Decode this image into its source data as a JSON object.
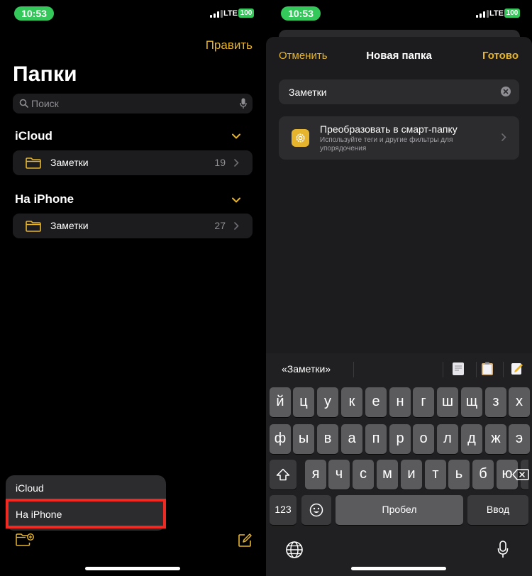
{
  "status_left": {
    "time": "10:53",
    "network": "LTE",
    "battery": "100"
  },
  "status_right": {
    "time": "10:53",
    "network": "LTE",
    "battery": "100"
  },
  "left": {
    "edit_label": "Править",
    "title": "Папки",
    "search_placeholder": "Поиск",
    "sections": [
      {
        "title": "iCloud",
        "folder": {
          "name": "Заметки",
          "count": "19"
        }
      },
      {
        "title": "На iPhone",
        "folder": {
          "name": "Заметки",
          "count": "27"
        }
      }
    ],
    "popup": {
      "options": [
        "iCloud",
        "На iPhone"
      ],
      "selected": "На iPhone"
    },
    "accent_color": "#e6b42d",
    "highlight_color": "#ee2a22"
  },
  "right": {
    "cancel_label": "Отменить",
    "title": "Новая папка",
    "done_label": "Готово",
    "name_value": "Заметки",
    "smart": {
      "title": "Преобразовать в смарт-папку",
      "description": "Используйте теги и другие фильтры для упорядочения"
    },
    "keyboard": {
      "suggestion": "«Заметки»",
      "row1": [
        "й",
        "ц",
        "у",
        "к",
        "е",
        "н",
        "г",
        "ш",
        "щ",
        "з",
        "х"
      ],
      "row2": [
        "ф",
        "ы",
        "в",
        "а",
        "п",
        "р",
        "о",
        "л",
        "д",
        "ж",
        "э"
      ],
      "row3": [
        "я",
        "ч",
        "с",
        "м",
        "и",
        "т",
        "ь",
        "б",
        "ю"
      ],
      "numbers_label": "123",
      "space_label": "Пробел",
      "return_label": "Ввод"
    }
  }
}
